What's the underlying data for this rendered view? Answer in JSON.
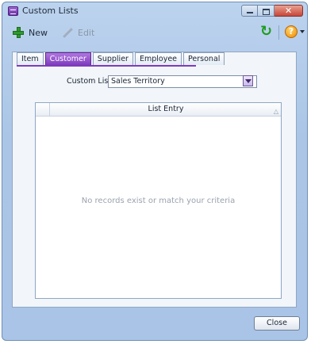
{
  "window": {
    "title": "Custom Lists"
  },
  "toolbar": {
    "new_label": "New",
    "edit_label": "Edit"
  },
  "tabs": [
    {
      "label": "Item",
      "active": false
    },
    {
      "label": "Customer",
      "active": true
    },
    {
      "label": "Supplier",
      "active": false
    },
    {
      "label": "Employee",
      "active": false
    },
    {
      "label": "Personal",
      "active": false
    }
  ],
  "custom_list": {
    "label": "Custom List:",
    "selected": "Sales Territory"
  },
  "table": {
    "column_header": "List Entry",
    "empty_message": "No records exist or match your criteria"
  },
  "footer": {
    "close_label": "Close"
  },
  "colors": {
    "active_tab": "#7e3cbd",
    "window_frame": "#aac5e6",
    "add_icon": "#2e9a2e"
  }
}
